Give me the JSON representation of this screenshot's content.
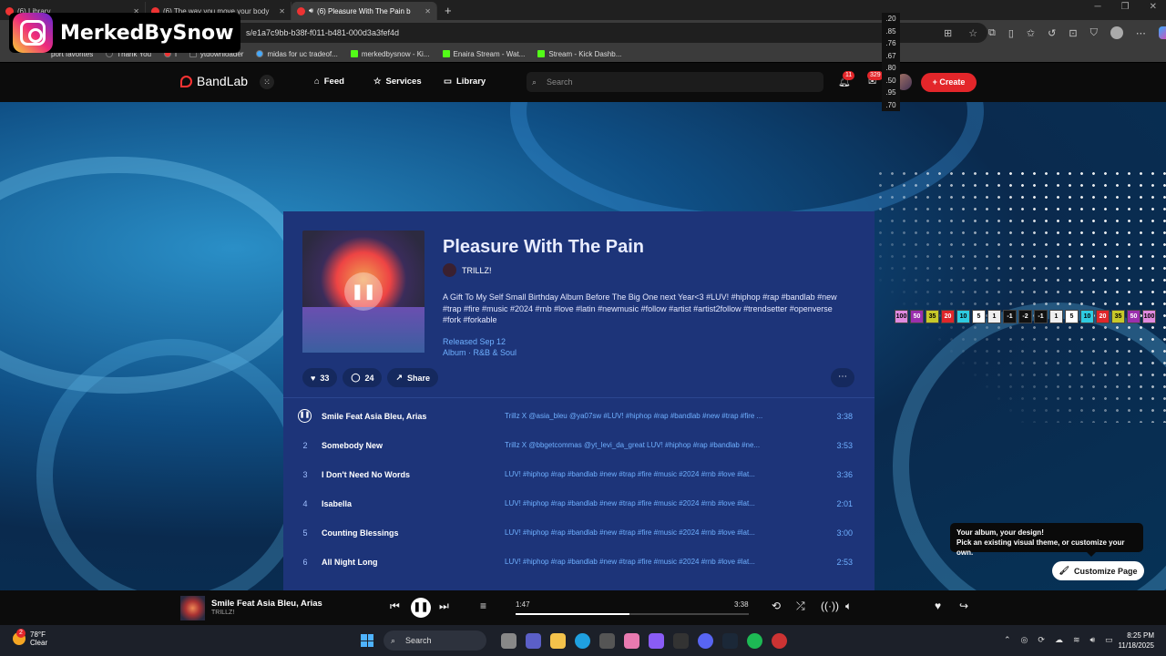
{
  "browser": {
    "tabs": [
      {
        "label": "(6) Library",
        "active": false
      },
      {
        "label": "(6) The way you move your body",
        "active": false
      },
      {
        "label": "(6) Pleasure With The Pain b",
        "active": true
      }
    ],
    "new_tab": "+",
    "address": "s/e1a7c9bb-b38f-f011-b481-000d3a3fef4d",
    "bookmarks": [
      "port favorites",
      "Thank You",
      "i",
      "ytdownloader",
      "midas for uc tradeof...",
      "merkedbysnow - Ki...",
      "Enaira Stream - Wat...",
      "Stream - Kick Dashb..."
    ]
  },
  "watermark": {
    "text": "MerkedBySnow"
  },
  "overlay_numbers": [
    ".20",
    ".85",
    ".76",
    ".67",
    ".80",
    ".50",
    ".95",
    ".70"
  ],
  "colorbar": [
    {
      "label": "100",
      "color": "#e08ae0"
    },
    {
      "label": "50",
      "color": "#9b2fae"
    },
    {
      "label": "35",
      "color": "#c7c92a"
    },
    {
      "label": "20",
      "color": "#e0262a"
    },
    {
      "label": "10",
      "color": "#2ecbe0"
    },
    {
      "label": "5",
      "color": "#ffffff"
    },
    {
      "label": "1",
      "color": "#eeeeee"
    },
    {
      "label": "-1",
      "color": "#111111"
    },
    {
      "label": "-2",
      "color": "#111111"
    },
    {
      "label": "-1",
      "color": "#111111"
    },
    {
      "label": "1",
      "color": "#eeeeee"
    },
    {
      "label": "5",
      "color": "#ffffff"
    },
    {
      "label": "10",
      "color": "#2ecbe0"
    },
    {
      "label": "20",
      "color": "#e0262a"
    },
    {
      "label": "35",
      "color": "#c7c92a"
    },
    {
      "label": "50",
      "color": "#9b2fae"
    },
    {
      "label": "100",
      "color": "#e08ae0"
    }
  ],
  "nav": {
    "brand": "BandLab",
    "feed": "Feed",
    "services": "Services",
    "library": "Library",
    "search_placeholder": "Search",
    "notif_count": "11",
    "msg_count": "329",
    "create": "Create"
  },
  "album": {
    "title": "Pleasure With The Pain",
    "artist": "TRILLZ!",
    "description": "A Gift To My Self Small Birthday Album Before The Big One next Year<3 #LUV! #hiphop #rap #bandlab #new #trap #fire #music #2024 #rnb #love #latin #newmusic #follow #artist #artist2follow #trendsetter #openverse #fork #forkable",
    "released": "Released Sep 12",
    "genre": "Album · R&B & Soul",
    "likes": "33",
    "comments": "24",
    "share": "Share"
  },
  "tracks": [
    {
      "num": "1",
      "name": "Smile Feat Asia Bleu, Arias",
      "desc": "Trillz X @asia_bleu @ya07sw #LUV! #hiphop #rap #bandlab #new #trap #fire ...",
      "dur": "3:38",
      "playing": true
    },
    {
      "num": "2",
      "name": "Somebody New",
      "desc": "Trillz X @bbgetcommas @yt_levi_da_great LUV! #hiphop #rap #bandlab #ne...",
      "dur": "3:53"
    },
    {
      "num": "3",
      "name": "I Don't Need No Words",
      "desc": "LUV! #hiphop #rap #bandlab #new #trap #fire #music #2024 #rnb #love #lat...",
      "dur": "3:36"
    },
    {
      "num": "4",
      "name": "Isabella",
      "desc": "LUV! #hiphop #rap #bandlab #new #trap #fire #music #2024 #rnb #love #lat...",
      "dur": "2:01"
    },
    {
      "num": "5",
      "name": "Counting Blessings",
      "desc": "LUV! #hiphop #rap #bandlab #new #trap #fire #music #2024 #rnb #love #lat...",
      "dur": "3:00"
    },
    {
      "num": "6",
      "name": "All Night Long",
      "desc": "LUV! #hiphop #rap #bandlab #new #trap #fire #music #2024 #rnb #love #lat...",
      "dur": "2:53"
    }
  ],
  "tooltip": {
    "line1": "Your album, your design!",
    "line2": "Pick an existing visual theme, or customize your own."
  },
  "customize": "Customize Page",
  "player": {
    "title": "Smile Feat Asia Bleu, Arias",
    "artist": "TRILLZ!",
    "elapsed": "1:47",
    "total": "3:38",
    "progress": 0.49
  },
  "taskbar": {
    "temp": "78°F",
    "condition": "Clear",
    "search": "Search",
    "notif_badge": "2",
    "time": "8:25 PM",
    "date": "11/18/2025"
  }
}
